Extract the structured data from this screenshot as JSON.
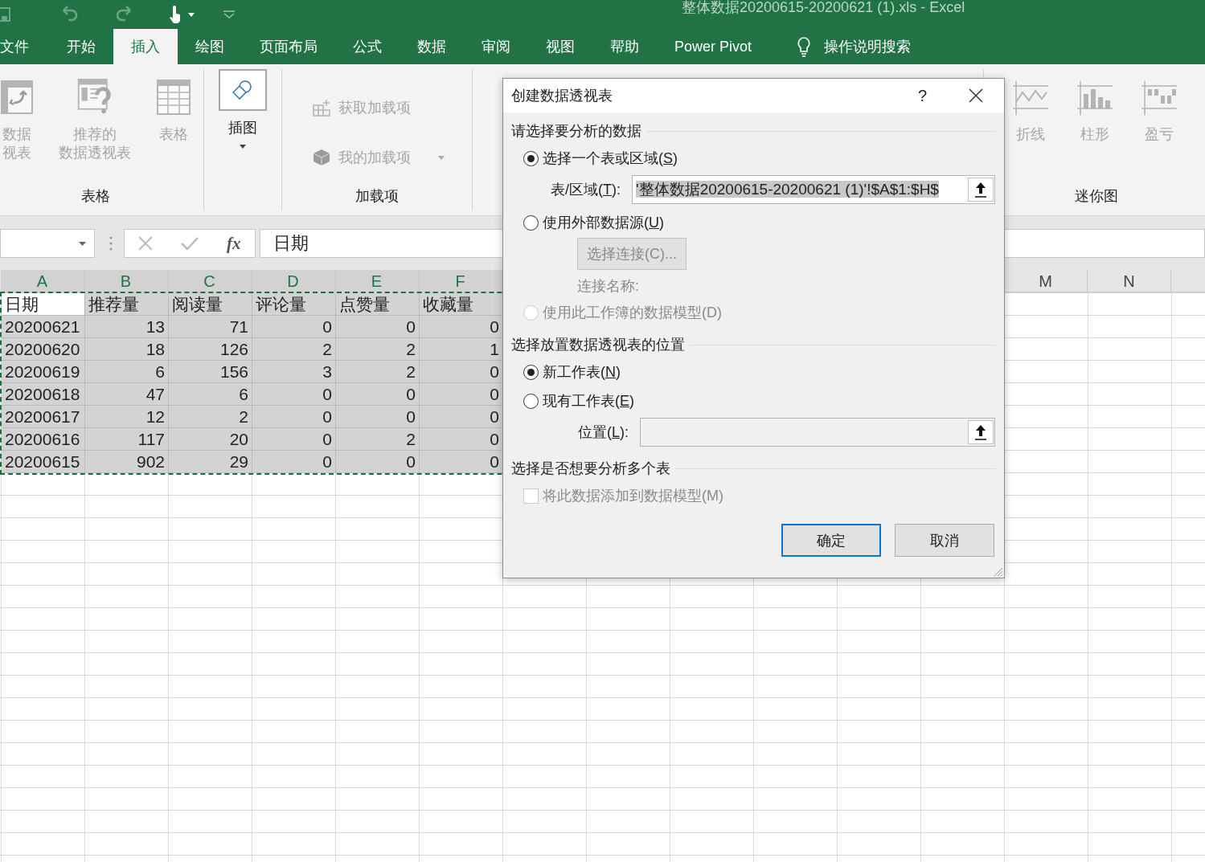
{
  "title_bar": {
    "title": "整体数据20200615-20200621 (1).xls  -  Excel"
  },
  "tabs": [
    {
      "label": "文件",
      "selected": false
    },
    {
      "label": "开始",
      "selected": false
    },
    {
      "label": "插入",
      "selected": true
    },
    {
      "label": "绘图",
      "selected": false
    },
    {
      "label": "页面布局",
      "selected": false
    },
    {
      "label": "公式",
      "selected": false
    },
    {
      "label": "数据",
      "selected": false
    },
    {
      "label": "审阅",
      "selected": false
    },
    {
      "label": "视图",
      "selected": false
    },
    {
      "label": "帮助",
      "selected": false
    },
    {
      "label": "Power Pivot",
      "selected": false
    }
  ],
  "tell_me": {
    "label": "操作说明搜索"
  },
  "ribbon_groups": [
    {
      "label": "表格",
      "items": [
        {
          "kind": "large",
          "lines": [
            "数据",
            "视表"
          ],
          "disabled": true
        },
        {
          "kind": "large",
          "lines": [
            "推荐的",
            "数据透视表"
          ],
          "disabled": true
        },
        {
          "kind": "large",
          "lines": [
            "表格"
          ],
          "disabled": true
        }
      ]
    },
    {
      "items": [
        {
          "kind": "boxed",
          "lines": [
            "插图"
          ],
          "disabled": false
        }
      ]
    },
    {
      "label": "加载项",
      "items": [
        {
          "kind": "small",
          "lines": [
            "获取加载项"
          ],
          "disabled": true
        },
        {
          "kind": "small",
          "lines": [
            "我的加载项"
          ],
          "disabled": true
        }
      ]
    },
    {
      "label": "迷你图",
      "items": [
        {
          "kind": "large",
          "lines": [
            "折线"
          ],
          "disabled": true
        },
        {
          "kind": "large",
          "lines": [
            "柱形"
          ],
          "disabled": true
        },
        {
          "kind": "large",
          "lines": [
            "盈亏"
          ],
          "disabled": true
        }
      ]
    }
  ],
  "formula_bar": {
    "function_label": "fx",
    "formula": "日期"
  },
  "sheet": {
    "columns": [
      "A",
      "B",
      "C",
      "D",
      "E",
      "F"
    ],
    "far_columns": [
      "M",
      "N"
    ],
    "rows": [
      {
        "kind": "header",
        "selected": true,
        "active_first": true,
        "cells": [
          "日期",
          "推荐量",
          "阅读量",
          "评论量",
          "点赞量",
          "收藏量"
        ]
      },
      {
        "kind": "data",
        "selected": true,
        "active_first": false,
        "cells": [
          "20200621",
          "13",
          "71",
          "0",
          "0",
          "0"
        ]
      },
      {
        "kind": "data",
        "selected": true,
        "active_first": false,
        "cells": [
          "20200620",
          "18",
          "126",
          "2",
          "2",
          "1"
        ]
      },
      {
        "kind": "data",
        "selected": true,
        "active_first": false,
        "cells": [
          "20200619",
          "6",
          "156",
          "3",
          "2",
          "0"
        ]
      },
      {
        "kind": "data",
        "selected": true,
        "active_first": false,
        "cells": [
          "20200618",
          "47",
          "6",
          "0",
          "0",
          "0"
        ]
      },
      {
        "kind": "data",
        "selected": true,
        "active_first": false,
        "cells": [
          "20200617",
          "12",
          "2",
          "0",
          "0",
          "0"
        ]
      },
      {
        "kind": "data",
        "selected": true,
        "active_first": false,
        "cells": [
          "20200616",
          "117",
          "20",
          "0",
          "2",
          "0"
        ]
      },
      {
        "kind": "data",
        "selected": true,
        "active_first": false,
        "cells": [
          "20200615",
          "902",
          "29",
          "0",
          "0",
          "0"
        ]
      }
    ]
  },
  "dialog": {
    "title": "创建数据透视表",
    "help": "?",
    "rows": [
      {
        "kind": "heading",
        "label": "请选择要分析的数据"
      },
      {
        "kind": "radio",
        "label": "选择一个表或区域(S)",
        "selected": true,
        "disabled": false,
        "mnemonic": true
      },
      {
        "kind": "field",
        "label": "表/区域(T):",
        "value": "'整体数据20200615-20200621 (1)'!$A$1:$H$",
        "mnemonic": true,
        "disabled": false
      },
      {
        "kind": "radio",
        "label": "使用外部数据源(U)",
        "selected": false,
        "disabled": false,
        "mnemonic": true
      },
      {
        "kind": "button",
        "label": "选择连接(C)...",
        "disabled": true
      },
      {
        "kind": "note",
        "label": "连接名称:",
        "disabled": true
      },
      {
        "kind": "radio",
        "label": "使用此工作簿的数据模型(D)",
        "selected": false,
        "disabled": true,
        "mnemonic": false
      },
      {
        "kind": "heading",
        "label": "选择放置数据透视表的位置"
      },
      {
        "kind": "radio",
        "label": "新工作表(N)",
        "selected": true,
        "disabled": false,
        "mnemonic": true
      },
      {
        "kind": "radio",
        "label": "现有工作表(E)",
        "selected": false,
        "disabled": false,
        "mnemonic": true
      },
      {
        "kind": "field",
        "label": "位置(L):",
        "value": "",
        "mnemonic": true,
        "disabled": true
      },
      {
        "kind": "heading",
        "label": "选择是否想要分析多个表"
      },
      {
        "kind": "checkbox",
        "label": "将此数据添加到数据模型(M)",
        "checked": false,
        "disabled": true
      }
    ],
    "buttons": [
      {
        "label": "确定",
        "default": true
      },
      {
        "label": "取消",
        "default": false
      }
    ]
  }
}
